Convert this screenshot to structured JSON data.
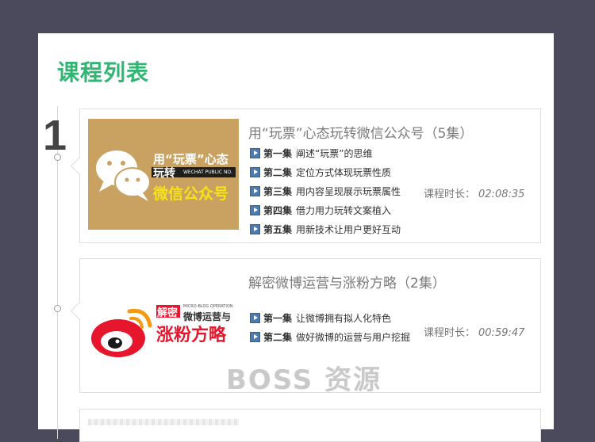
{
  "page": {
    "title": "课程列表",
    "step_number": "1",
    "watermark": "BOSS 资源",
    "accent_color": "#2fb673"
  },
  "courses": [
    {
      "title": "用“玩票”心态玩转微信公众号（5集）",
      "thumb": {
        "line1": "用“玩票”心态",
        "line2": "玩转",
        "line2_tag": "WECHAT PUBLIC NO.",
        "line3": "微信公众号",
        "icon": "wechat-logo-icon"
      },
      "episodes": [
        {
          "num": "第一集",
          "title": "阐述“玩票”的思维"
        },
        {
          "num": "第二集",
          "title": "定位方式体现玩票性质"
        },
        {
          "num": "第三集",
          "title": "用内容呈现展示玩票属性"
        },
        {
          "num": "第四集",
          "title": "借力用力玩转文案植入"
        },
        {
          "num": "第五集",
          "title": "用新技术让用户更好互动"
        }
      ],
      "duration_label": "课程时长：",
      "duration": "02:08:35"
    },
    {
      "title": "解密微博运营与涨粉方略（2集）",
      "thumb": {
        "tag": "解密",
        "small_en": "MICRO-BLOG OPERATION",
        "line1": "微博运营与",
        "line2": "涨粉方略",
        "icon": "weibo-logo-icon"
      },
      "episodes": [
        {
          "num": "第一集",
          "title": "让微博拥有拟人化特色"
        },
        {
          "num": "第二集",
          "title": "做好微博的运营与用户挖掘"
        }
      ],
      "duration_label": "课程时长：",
      "duration": "00:59:47"
    }
  ]
}
